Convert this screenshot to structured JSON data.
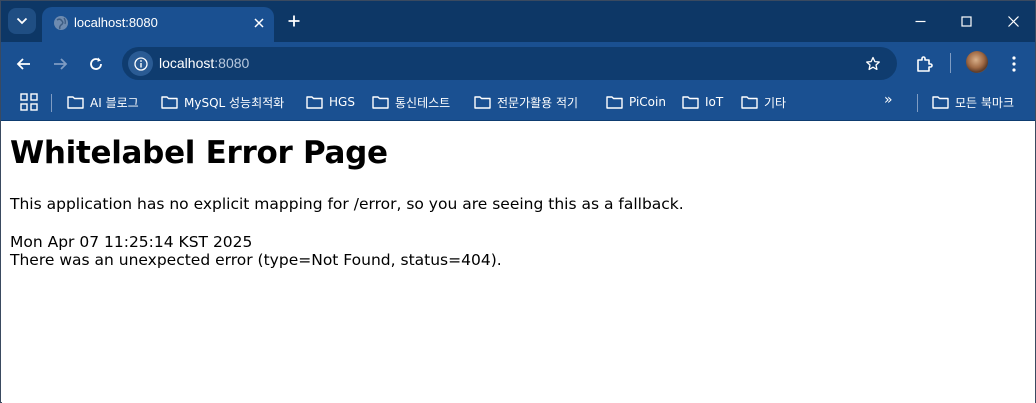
{
  "tab": {
    "title": "localhost:8080"
  },
  "omnibox": {
    "host": "localhost",
    "port": ":8080"
  },
  "bookmarks": [
    {
      "label": "AI 블로그"
    },
    {
      "label": "MySQL 성능최적화"
    },
    {
      "label": "HGS"
    },
    {
      "label": "통신테스트"
    },
    {
      "label": "전문가활용 적기"
    },
    {
      "label": "PiCoin"
    },
    {
      "label": "IoT"
    },
    {
      "label": "기타"
    }
  ],
  "bookmarks_more": "»",
  "all_bookmarks": "모든 북마크",
  "page": {
    "heading": "Whitelabel Error Page",
    "message": "This application has no explicit mapping for /error, so you are seeing this as a fallback.",
    "timestamp": "Mon Apr 07 11:25:14 KST 2025",
    "error": "There was an unexpected error (type=Not Found, status=404)."
  },
  "colors": {
    "tabstrip": "#0d3766",
    "toolbar": "#1a5091",
    "omnibox": "#0f3c6f",
    "page_bg": "#ffffff"
  }
}
